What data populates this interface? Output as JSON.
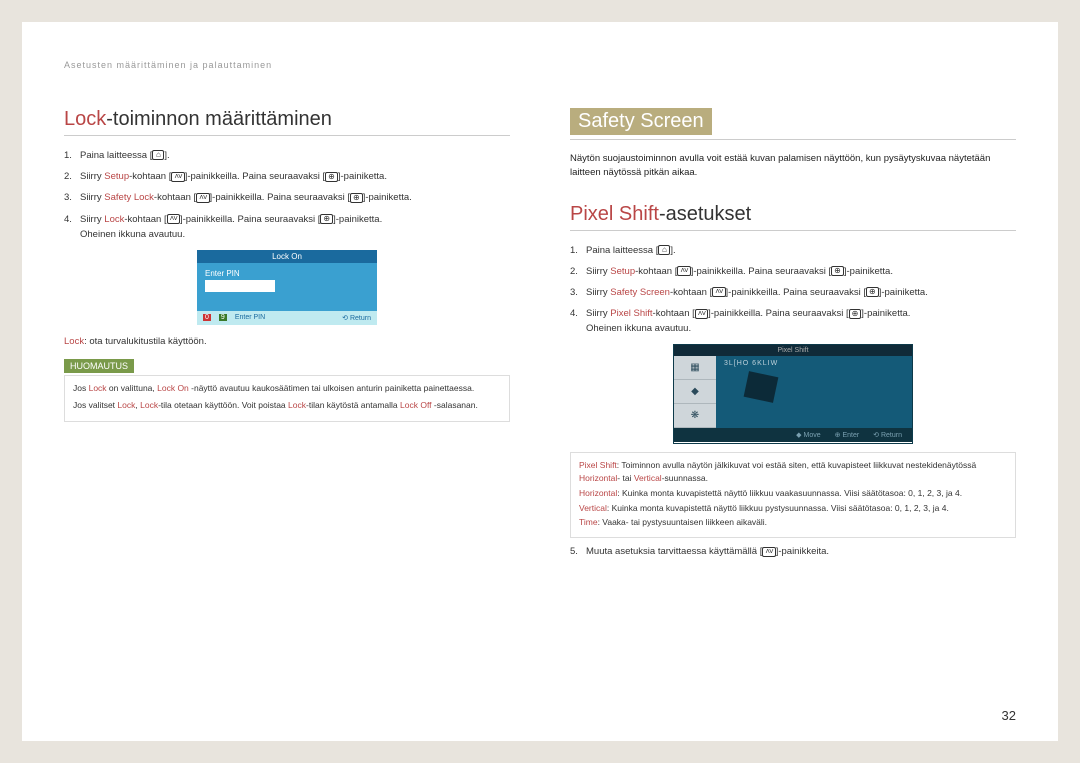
{
  "breadcrumb": "Asetusten määrittäminen ja palauttaminen",
  "left": {
    "title_accent": "Lock",
    "title_rest": "-toiminnon määrittäminen",
    "steps": [
      {
        "n": "1.",
        "pre": "Paina laitteessa [",
        "icon": "home",
        "post": "]."
      },
      {
        "n": "2.",
        "pre": "Siirry ",
        "red": "Setup",
        "mid": "-kohtaan [",
        "icon": "updown",
        "mid2": "]-painikkeilla. Paina seuraavaksi [",
        "icon2": "enter",
        "post": "]-painiketta."
      },
      {
        "n": "3.",
        "pre": "Siirry ",
        "red": "Safety Lock",
        "mid": "-kohtaan [",
        "icon": "updown",
        "mid2": "]-painikkeilla. Paina seuraavaksi [",
        "icon2": "enter",
        "post": "]-painiketta."
      },
      {
        "n": "4.",
        "pre": "Siirry ",
        "red": "Lock",
        "mid": "-kohtaan [",
        "icon": "updown",
        "mid2": "]-painikkeilla. Paina seuraavaksi [",
        "icon2": "enter",
        "post": "]-painiketta.",
        "tail": "Oheinen ikkuna avautuu."
      }
    ],
    "lock_ui": {
      "title": "Lock On",
      "label": "Enter PIN",
      "footer": [
        "0",
        "9",
        "Enter PIN",
        "Return"
      ]
    },
    "desc_red": "Lock",
    "desc_rest": ": ota turvalukitustila käyttöön.",
    "note_label": "HUOMAUTUS",
    "note_p1a": "Jos ",
    "note_p1b": "Lock",
    "note_p1c": " on valittuna, ",
    "note_p1d": "Lock On",
    "note_p1e": " -näyttö avautuu kaukosäätimen tai ulkoisen anturin painiketta painettaessa.",
    "note_p2a": "Jos valitset ",
    "note_p2b": "Lock",
    "note_p2c": ", ",
    "note_p2d": "Lock",
    "note_p2e": "-tila otetaan käyttöön. Voit poistaa ",
    "note_p2f": "Lock",
    "note_p2g": "-tilan käytöstä antamalla ",
    "note_p2h": "Lock Off",
    "note_p2i": " -salasanan."
  },
  "right": {
    "box_title": "Safety Screen",
    "intro": "Näytön suojaustoiminnon avulla voit estää kuvan palamisen näyttöön, kun pysäytyskuvaa näytetään laitteen näytössä pitkän aikaa.",
    "h2_accent": "Pixel Shift",
    "h2_rest": "-asetukset",
    "steps": [
      {
        "n": "1.",
        "pre": "Paina laitteessa [",
        "icon": "home",
        "post": "]."
      },
      {
        "n": "2.",
        "pre": "Siirry ",
        "red": "Setup",
        "mid": "-kohtaan [",
        "icon": "updown",
        "mid2": "]-painikkeilla. Paina seuraavaksi [",
        "icon2": "enter",
        "post": "]-painiketta."
      },
      {
        "n": "3.",
        "pre": "Siirry ",
        "red": "Safety Screen",
        "mid": "-kohtaan [",
        "icon": "updown",
        "mid2": "]-painikkeilla. Paina seuraavaksi [",
        "icon2": "enter",
        "post": "]-painiketta."
      },
      {
        "n": "4.",
        "pre": "Siirry ",
        "red": "Pixel Shift",
        "mid": "-kohtaan [",
        "icon": "updown",
        "mid2": "]-painikkeilla. Paina seuraavaksi [",
        "icon2": "enter",
        "post": "]-painiketta.",
        "tail": "Oheinen ikkuna avautuu."
      }
    ],
    "pixel_ui": {
      "title": "Pixel Shift",
      "rows": [
        "3L[HO 6KLIW"
      ],
      "footer": [
        "Move",
        "Enter",
        "Return"
      ]
    },
    "labels": {
      "a1": "Pixel Shift",
      "a2": ": Toiminnon avulla näytön jälkikuvat voi estää siten, että kuvapisteet liikkuvat nestekidenäytössä ",
      "a3": "Horizontal",
      "a4": "- tai ",
      "a5": "Vertical",
      "a6": "-suunnassa.",
      "b1": "Horizontal",
      "b2": ": Kuinka monta kuvapistettä näyttö liikkuu vaakasuunnassa. Viisi säätötasoa: 0, 1, 2, 3, ja 4.",
      "c1": "Vertical",
      "c2": ": Kuinka monta kuvapistettä näyttö liikkuu pystysuunnassa. Viisi säätötasoa: 0, 1, 2, 3, ja 4.",
      "d1": "Time",
      "d2": ": Vaaka- tai pystysuuntaisen liikkeen aikaväli."
    },
    "step5_pre": "Muuta asetuksia tarvittaessa käyttämällä [",
    "step5_post": "]-painikkeita.",
    "step5_n": "5."
  },
  "page_num": "32"
}
